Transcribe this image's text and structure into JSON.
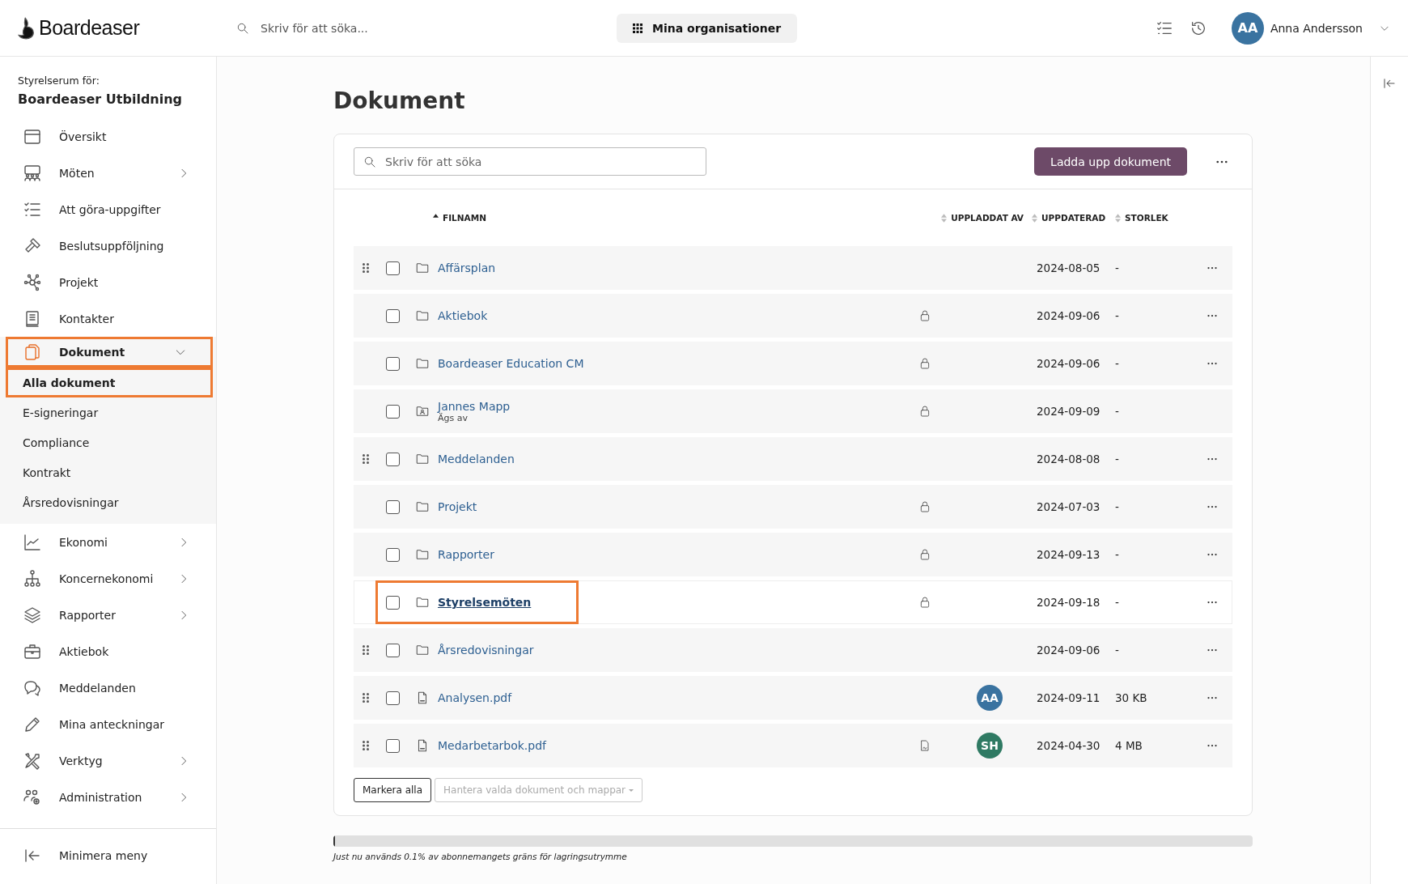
{
  "topbar": {
    "brand": "Boardeaser",
    "search_placeholder": "Skriv för att söka...",
    "org_button": "Mina organisationer",
    "user": {
      "initials": "AA",
      "name": "Anna Andersson",
      "color": "#3a73a0"
    }
  },
  "sidebar": {
    "caption": "Styrelserum för:",
    "org": "Boardeaser Utbildning",
    "items": [
      {
        "label": "Översikt",
        "chevron": false,
        "expanded": false,
        "selected": false,
        "highlighted": false
      },
      {
        "label": "Möten",
        "chevron": true,
        "expanded": false,
        "selected": false,
        "highlighted": false
      },
      {
        "label": "Att göra-uppgifter",
        "chevron": false,
        "expanded": false,
        "selected": false,
        "highlighted": false
      },
      {
        "label": "Beslutsuppföljning",
        "chevron": false,
        "expanded": false,
        "selected": false,
        "highlighted": false
      },
      {
        "label": "Projekt",
        "chevron": false,
        "expanded": false,
        "selected": false,
        "highlighted": false
      },
      {
        "label": "Kontakter",
        "chevron": false,
        "expanded": false,
        "selected": false,
        "highlighted": false
      },
      {
        "label": "Dokument",
        "chevron": true,
        "expanded": true,
        "selected": true,
        "highlighted": true,
        "children": [
          {
            "label": "Alla dokument",
            "selected": true,
            "highlighted": true
          },
          {
            "label": "E-signeringar",
            "selected": false,
            "highlighted": false
          },
          {
            "label": "Compliance",
            "selected": false,
            "highlighted": false
          },
          {
            "label": "Kontrakt",
            "selected": false,
            "highlighted": false
          },
          {
            "label": "Årsredovisningar",
            "selected": false,
            "highlighted": false
          }
        ]
      },
      {
        "label": "Ekonomi",
        "chevron": true,
        "expanded": false,
        "selected": false,
        "highlighted": false
      },
      {
        "label": "Koncernekonomi",
        "chevron": true,
        "expanded": false,
        "selected": false,
        "highlighted": false
      },
      {
        "label": "Rapporter",
        "chevron": true,
        "expanded": false,
        "selected": false,
        "highlighted": false
      },
      {
        "label": "Aktiebok",
        "chevron": false,
        "expanded": false,
        "selected": false,
        "highlighted": false
      },
      {
        "label": "Meddelanden",
        "chevron": false,
        "expanded": false,
        "selected": false,
        "highlighted": false
      },
      {
        "label": "Mina anteckningar",
        "chevron": false,
        "expanded": false,
        "selected": false,
        "highlighted": false
      },
      {
        "label": "Verktyg",
        "chevron": true,
        "expanded": false,
        "selected": false,
        "highlighted": false
      },
      {
        "label": "Administration",
        "chevron": true,
        "expanded": false,
        "selected": false,
        "highlighted": false
      }
    ],
    "footer": "Minimera meny"
  },
  "page": {
    "title": "Dokument",
    "search_placeholder": "Skriv för att söka",
    "upload_button": "Ladda upp dokument"
  },
  "table": {
    "columns": [
      {
        "label": "FILNAMN",
        "sorted": true
      },
      {
        "label": "UPPLADDAT AV",
        "sorted": false
      },
      {
        "label": "UPPDATERAD",
        "sorted": false
      },
      {
        "label": "STORLEK",
        "sorted": false
      }
    ],
    "rows": [
      {
        "kind": "folder",
        "name": "Affärsplan",
        "updated": "2024-08-05",
        "size": "-",
        "draggable": true,
        "locked": false,
        "menu": true,
        "hovered": false,
        "highlighted": false
      },
      {
        "kind": "folder",
        "name": "Aktiebok",
        "updated": "2024-09-06",
        "size": "-",
        "draggable": false,
        "locked": true,
        "menu": true,
        "hovered": false,
        "highlighted": false
      },
      {
        "kind": "folder",
        "name": "Boardeaser Education CM",
        "updated": "2024-09-06",
        "size": "-",
        "draggable": false,
        "locked": true,
        "menu": true,
        "hovered": false,
        "highlighted": false
      },
      {
        "kind": "personal-folder",
        "name": "Jannes Mapp",
        "subtitle": "Ägs av",
        "updated": "2024-09-09",
        "size": "-",
        "draggable": false,
        "locked": true,
        "menu": false,
        "hovered": false,
        "highlighted": false
      },
      {
        "kind": "folder",
        "name": "Meddelanden",
        "updated": "2024-08-08",
        "size": "-",
        "draggable": true,
        "locked": false,
        "menu": true,
        "hovered": false,
        "highlighted": false
      },
      {
        "kind": "folder",
        "name": "Projekt",
        "updated": "2024-07-03",
        "size": "-",
        "draggable": false,
        "locked": true,
        "menu": true,
        "hovered": false,
        "highlighted": false
      },
      {
        "kind": "folder",
        "name": "Rapporter",
        "updated": "2024-09-13",
        "size": "-",
        "draggable": false,
        "locked": true,
        "menu": true,
        "hovered": false,
        "highlighted": false
      },
      {
        "kind": "folder",
        "name": "Styrelsemöten",
        "updated": "2024-09-18",
        "size": "-",
        "draggable": false,
        "locked": true,
        "menu": true,
        "hovered": true,
        "highlighted": true
      },
      {
        "kind": "folder",
        "name": "Årsredovisningar",
        "updated": "2024-09-06",
        "size": "-",
        "draggable": true,
        "locked": false,
        "menu": true,
        "hovered": false,
        "highlighted": false
      },
      {
        "kind": "pdf",
        "name": "Analysen.pdf",
        "updated": "2024-09-11",
        "size": "30 KB",
        "draggable": true,
        "locked": false,
        "signed": false,
        "uploader": {
          "initials": "AA",
          "color": "#3a73a0"
        },
        "menu": true,
        "hovered": false,
        "highlighted": false
      },
      {
        "kind": "pdf",
        "name": "Medarbetarbok.pdf",
        "updated": "2024-04-30",
        "size": "4 MB",
        "draggable": true,
        "locked": false,
        "signed": true,
        "uploader": {
          "initials": "SH",
          "color": "#2f7a63"
        },
        "menu": true,
        "hovered": false,
        "highlighted": false
      }
    ]
  },
  "actions": {
    "select_all": "Markera alla",
    "bulk_menu": "Hantera valda dokument och mappar"
  },
  "storage": {
    "level": 0.001,
    "caption": "Just nu används 0.1% av abonnemangets gräns för lagringsutrymme"
  }
}
